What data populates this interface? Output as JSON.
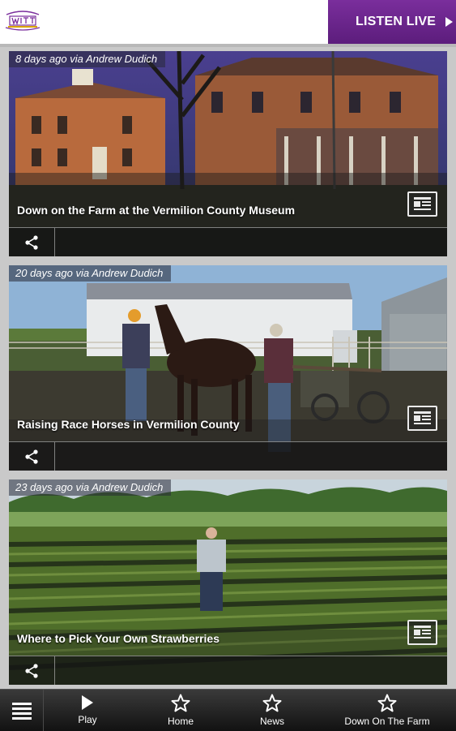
{
  "header": {
    "listen_live_label": "LISTEN LIVE"
  },
  "articles": [
    {
      "meta": "8 days ago via Andrew Dudich",
      "title": "Down on the Farm at the Vermilion County Museum"
    },
    {
      "meta": "20 days ago via Andrew Dudich",
      "title": "Raising Race Horses in Vermilion County"
    },
    {
      "meta": "23 days ago via Andrew Dudich",
      "title": "Where to Pick Your Own Strawberries"
    }
  ],
  "nav": {
    "items": [
      {
        "label": "Play",
        "icon": "play-icon"
      },
      {
        "label": "Home",
        "icon": "star-icon"
      },
      {
        "label": "News",
        "icon": "star-icon"
      },
      {
        "label": "Down On The Farm",
        "icon": "star-icon"
      }
    ]
  },
  "colors": {
    "accent": "#6a2589",
    "background": "#c9c9c9"
  }
}
